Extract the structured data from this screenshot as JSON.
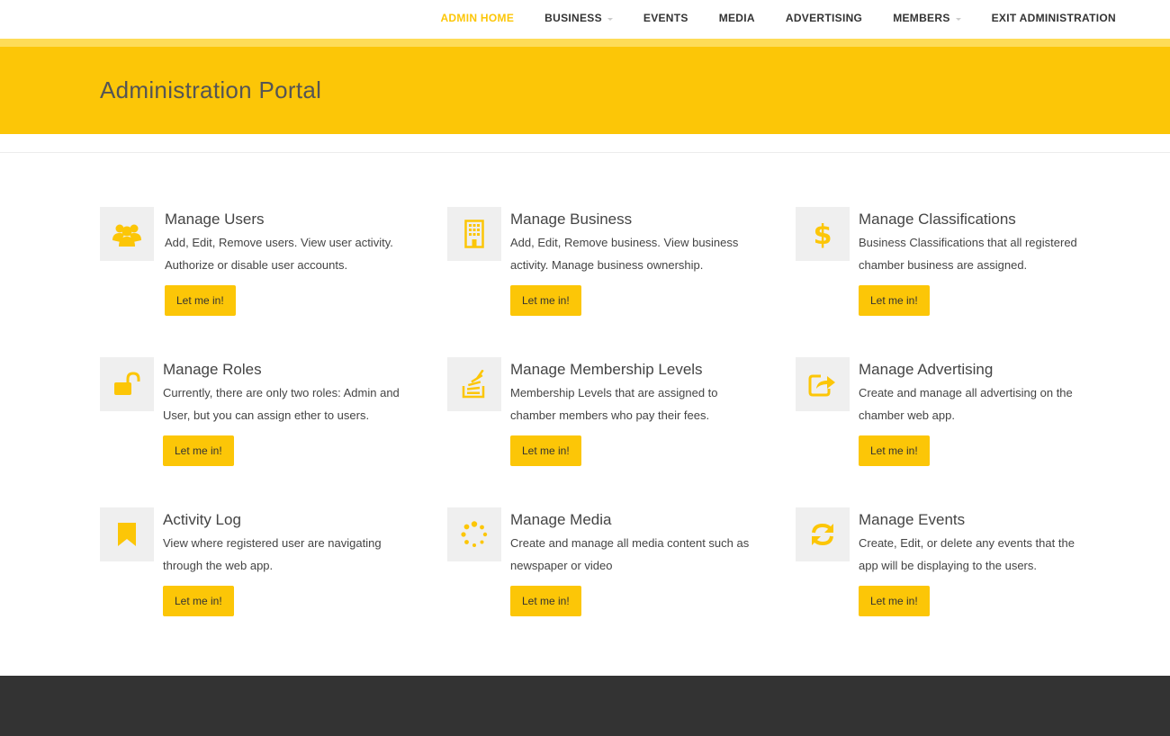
{
  "nav": {
    "items": [
      {
        "label": "ADMIN HOME",
        "active": true,
        "dropdown": false
      },
      {
        "label": "BUSINESS",
        "active": false,
        "dropdown": true
      },
      {
        "label": "EVENTS",
        "active": false,
        "dropdown": false
      },
      {
        "label": "MEDIA",
        "active": false,
        "dropdown": false
      },
      {
        "label": "ADVERTISING",
        "active": false,
        "dropdown": false
      },
      {
        "label": "MEMBERS",
        "active": false,
        "dropdown": true
      },
      {
        "label": "EXIT ADMINISTRATION",
        "active": false,
        "dropdown": false
      }
    ]
  },
  "banner": {
    "title": "Administration Portal"
  },
  "colors": {
    "accent": "#fcc607",
    "accent_light": "#fedc57",
    "icon_bg": "#efefef",
    "footer": "#333333"
  },
  "cards": [
    {
      "icon": "users-icon",
      "title": "Manage Users",
      "desc_line1": "Add, Edit, Remove users. View user activity.",
      "desc_line2": "Authorize or disable user accounts.",
      "button": "Let me in!"
    },
    {
      "icon": "building-icon",
      "title": "Manage Business",
      "desc_line1": "Add, Edit, Remove business. View business",
      "desc_line2": "activity. Manage business ownership.",
      "button": "Let me in!"
    },
    {
      "icon": "dollar-icon",
      "title": "Manage Classifications",
      "desc_line1": "Business Classifications that all registered",
      "desc_line2": "chamber business are assigned.",
      "button": "Let me in!"
    },
    {
      "icon": "unlock-icon",
      "title": "Manage Roles",
      "desc_line1": "Currently, there are only two roles: Admin and",
      "desc_line2": "User, but you can assign ether to users.",
      "button": "Let me in!"
    },
    {
      "icon": "stack-icon",
      "title": "Manage Membership Levels",
      "desc_line1": "Membership Levels that are assigned to",
      "desc_line2": "chamber members who pay their fees.",
      "button": "Let me in!"
    },
    {
      "icon": "share-icon",
      "title": "Manage Advertising",
      "desc_line1": "Create and manage all advertising on the",
      "desc_line2": "chamber web app.",
      "button": "Let me in!"
    },
    {
      "icon": "bookmark-icon",
      "title": "Activity Log",
      "desc_line1": "View where registered user are navigating",
      "desc_line2": "through the web app.",
      "button": "Let me in!"
    },
    {
      "icon": "spinner-icon",
      "title": "Manage Media",
      "desc_line1": "Create and manage all media content such as",
      "desc_line2": "newspaper or video",
      "button": "Let me in!"
    },
    {
      "icon": "refresh-icon",
      "title": "Manage Events",
      "desc_line1": "Create, Edit, or delete any events that the",
      "desc_line2": "app will be displaying to the users.",
      "button": "Let me in!"
    }
  ]
}
